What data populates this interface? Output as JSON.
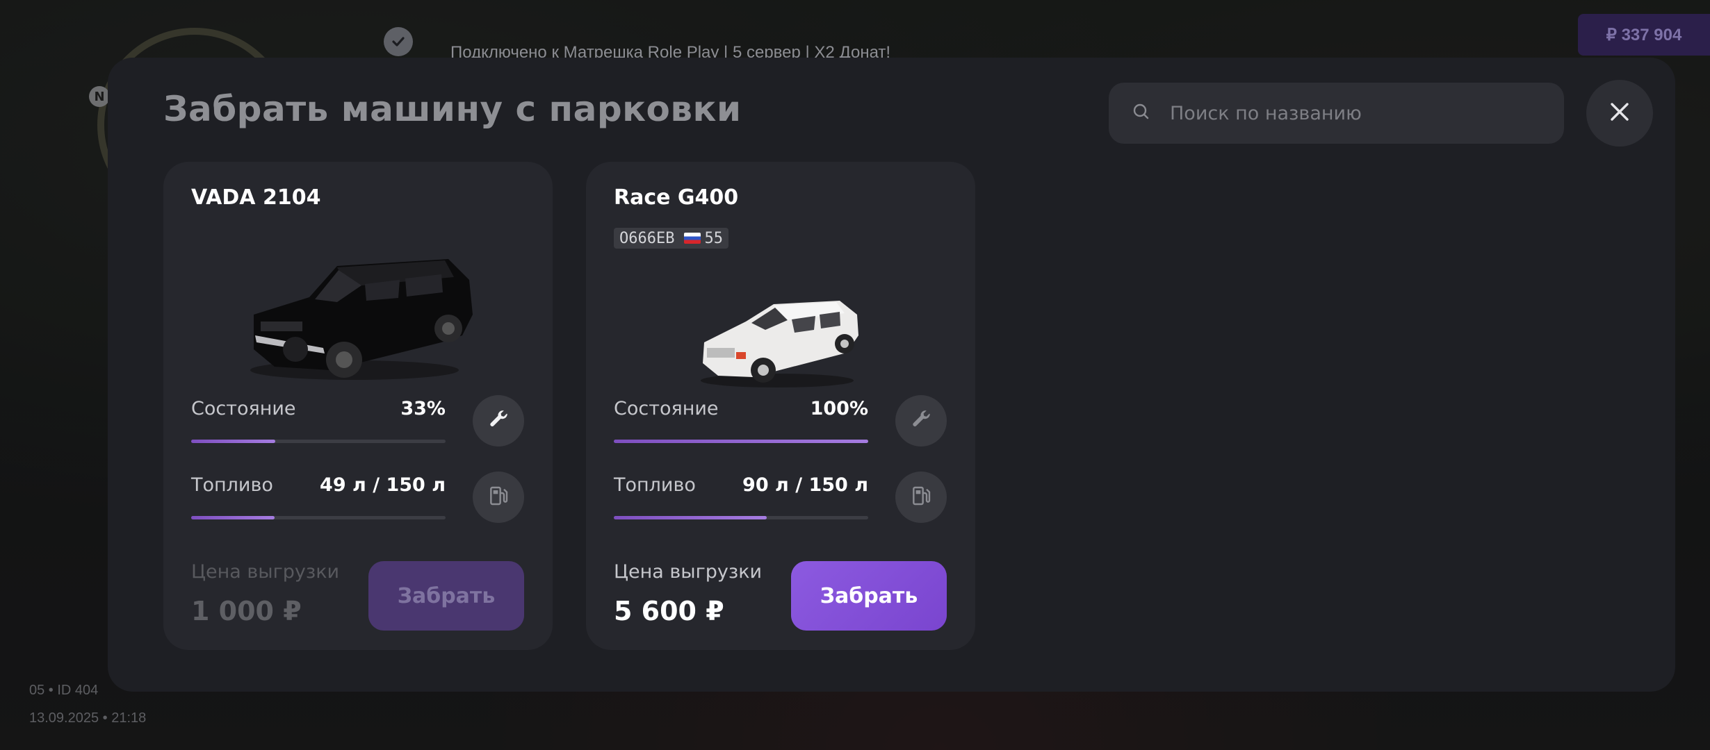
{
  "hud": {
    "server_text": "Подключено к Матрешка Role Play | 5 сервер | X2 Донат!",
    "money": "₽ 337 904",
    "compass": "N",
    "id_line": "05 • ID 404",
    "datetime": "13.09.2025 • 21:18"
  },
  "modal": {
    "title": "Забрать машину с парковки",
    "search_placeholder": "Поиск по названию"
  },
  "cars": [
    {
      "name": "VADA 2104",
      "condition_label": "Состояние",
      "condition_value": "33%",
      "condition_fraction": 0.33,
      "fuel_label": "Топливо",
      "fuel_value": "49 л / 150 л",
      "fuel_fraction": 0.327,
      "price_label": "Цена выгрузки",
      "price_value": "1 000 ₽",
      "button_label": "Забрать",
      "button_enabled": false,
      "color": "#0b0b0c"
    },
    {
      "name": "Race G400",
      "plate": "O666EB",
      "region": "55",
      "condition_label": "Состояние",
      "condition_value": "100%",
      "condition_fraction": 1.0,
      "fuel_label": "Топливо",
      "fuel_value": "90 л / 150 л",
      "fuel_fraction": 0.6,
      "price_label": "Цена выгрузки",
      "price_value": "5 600 ₽",
      "button_label": "Забрать",
      "button_enabled": true,
      "color": "#eceaea"
    }
  ],
  "colors": {
    "accent": "#8c5ae0",
    "modal_bg": "#1e1f24",
    "card_bg": "#26272d"
  }
}
